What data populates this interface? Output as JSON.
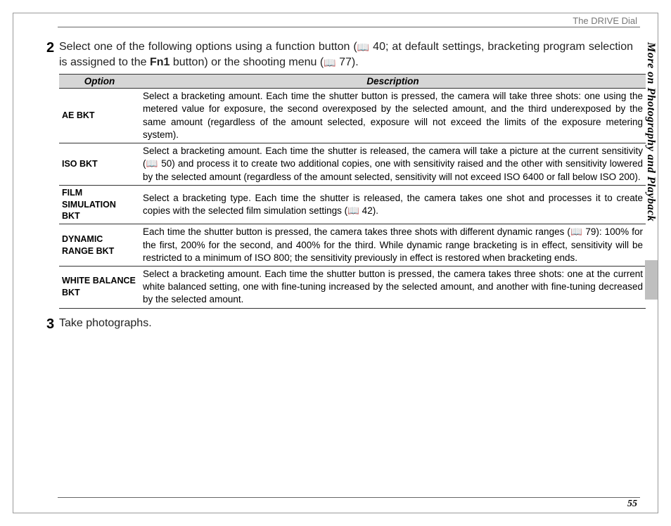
{
  "header": {
    "section": "The DRIVE Dial"
  },
  "sidebar": {
    "chapter": "More on Photography and Playback"
  },
  "page_number": "55",
  "step2": {
    "num": "2",
    "text_pre": "Select one of the following options using a function button (",
    "ref1": " 40; at default settings, bracketing program selection is assigned to the ",
    "fn": "Fn1",
    "text_mid": " button) or the shooting menu (",
    "ref2": " 77)."
  },
  "step3": {
    "num": "3",
    "text": "Take photographs."
  },
  "table": {
    "headers": {
      "option": "Option",
      "description": "Description"
    },
    "rows": [
      {
        "option": "AE BKT",
        "desc": "Select a bracketing amount.  Each time the shutter button is pressed, the camera will take three shots: one using the metered value for exposure, the second overexposed by the selected amount, and the third underexposed by the same amount (regardless of the amount selected, exposure will not exceed the limits of the exposure metering system)."
      },
      {
        "option": "ISO BKT",
        "desc": "Select a bracketing amount.  Each time the shutter is released, the camera will take a picture at the current sensitivity (📖 50) and process it to create two additional copies, one with sensitivity raised and the other with sensitivity lowered by the selected amount (regardless of the amount selected, sensitivity will not exceed ISO 6400 or fall below ISO 200)."
      },
      {
        "option": "FILM SIMULATION BKT",
        "desc": "Select a bracketing type.  Each time the shutter is released, the camera takes one shot and processes it to create copies with the selected film simulation settings (📖 42)."
      },
      {
        "option": "DYNAMIC RANGE BKT",
        "desc": "Each time the shutter button is pressed, the camera takes three shots with different dynamic ranges (📖 79): 100% for the first, 200% for the second, and 400% for the third.  While dynamic range bracketing is in effect, sensitivity will be restricted to a minimum of ISO 800; the sensitivity previously in effect is restored when bracketing ends."
      },
      {
        "option": "WHITE BALANCE BKT",
        "desc": "Select a bracketing amount.  Each time the shutter button is pressed, the camera takes three shots: one at the current white balanced setting, one with fine-tuning increased by the selected amount, and another with fine-tuning decreased by the selected amount."
      }
    ]
  }
}
